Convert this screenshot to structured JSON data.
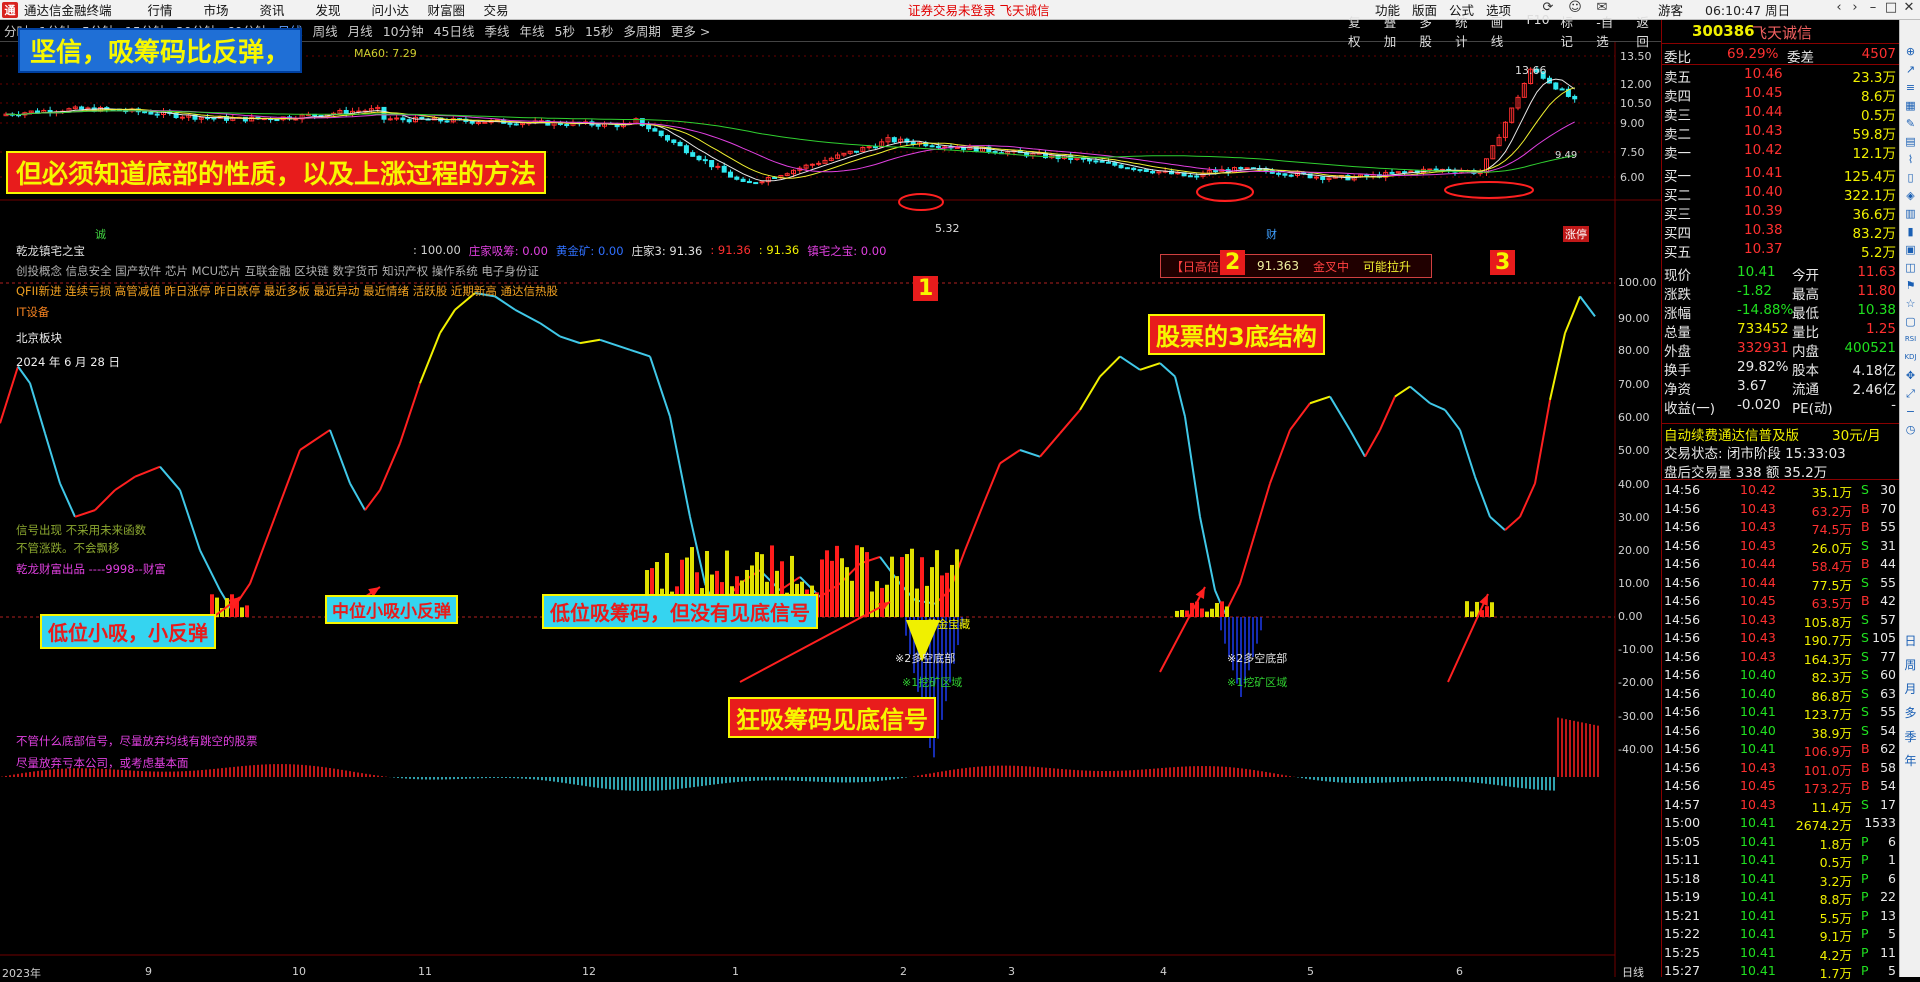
{
  "app": {
    "logo_text": "通",
    "title": "通达信金融终端",
    "menu": [
      "行情",
      "市场",
      "资讯",
      "发现",
      "问小达",
      "财富圈",
      "交易"
    ],
    "warning": "证券交易未登录  飞天诚信",
    "right_menu": [
      "功能",
      "版面",
      "公式",
      "选项"
    ],
    "guest": "游客",
    "clock": "06:10:47 周日"
  },
  "toolbar": {
    "periods": [
      "分时",
      "1分钟",
      "5分钟",
      "15分钟",
      "30分钟",
      "60分钟",
      "日线",
      "周线",
      "月线",
      "10分钟",
      "45日线",
      "季线",
      "年线",
      "5秒",
      "15秒",
      "多周期",
      "更多 >"
    ],
    "active_period": "日线",
    "tools": [
      "复权",
      "叠加",
      "多股",
      "统计",
      "画线",
      "F10",
      "标记",
      "-自选",
      "返回"
    ]
  },
  "kline": {
    "ma_label": "MA60: 7.29",
    "price_ticks": [
      "13.50",
      "12.00",
      "10.50",
      "9.00",
      "7.50",
      "6.00"
    ],
    "high_label": "13.66",
    "low_label": "5.32",
    "last_label": "9.49",
    "mark_cheng": "诚",
    "mark_cai": "财",
    "mark_zhangting": "涨停"
  },
  "indicator": {
    "name": "乾龙镇宅之宝",
    "params": [
      {
        "t": ": 100.00",
        "c": "#d0d0d0"
      },
      {
        "t": "庄家吸筹: 0.00",
        "c": "#e040e0"
      },
      {
        "t": "黄金矿: 0.00",
        "c": "#3070ff"
      },
      {
        "t": "庄家3: 91.36",
        "c": "#e0e0e0"
      },
      {
        "t": ": 91.36",
        "c": "#ff3030"
      },
      {
        "t": ": 91.36",
        "c": "#f0f000"
      },
      {
        "t": "镇宅之宝: 0.00",
        "c": "#e040e0"
      }
    ],
    "concepts": "创投概念 信息安全 国产软件 芯片 MCU芯片 互联金融 区块链 数字货币 知识产权 操作系统 电子身份证",
    "concepts2": "QFII新进 连续亏损 高管减值 昨日涨停 昨日跌停 最近多板 最近异动 最近情绪 活跃股 近期新高 通达信热股",
    "it": "IT设备",
    "bj": "北京板块",
    "date": "2024 年 6 月 28 日",
    "signal1": "信号出现  不采用未来函数",
    "signal2": "不管涨跌。不会飘移",
    "credit": "乾龙财富出品 ----9998--财富",
    "warn1": "不管什么底部信号，尽量放弃均线有跳空的股票",
    "warn2": "尽量放弃亏本公司，或考虑基本面",
    "ticks": [
      "100.00",
      "90.00",
      "80.00",
      "70.00",
      "60.00",
      "50.00",
      "40.00",
      "30.00",
      "20.00",
      "10.00",
      "0.00",
      "-10.00",
      "-20.00",
      "-30.00",
      "-40.00"
    ],
    "box_a": "【日高倍",
    "box_b": "91.363",
    "box_c": "金叉中",
    "box_d": "可能拉升",
    "note_gold": "※3黄金宝藏",
    "note_duokong1": "※2多空底部",
    "note_wak1": "※1挖矿区域",
    "note_duokong2": "※2多空底部",
    "note_wak2": "※1挖矿区域"
  },
  "xaxis": {
    "labels": [
      "2023年",
      "9",
      "10",
      "11",
      "12",
      "1",
      "2",
      "3",
      "4",
      "5",
      "6"
    ],
    "right": "日线"
  },
  "banners": {
    "b1": "坚信，吸筹码比反弹，",
    "b2": "但必须知道底部的性质，以及上涨过程的方法",
    "b3": "股票的3底结构",
    "n1": "1",
    "n2": "2",
    "n3": "3",
    "c1": "低位小吸，小反弹",
    "c2": "中位小吸小反弹",
    "c3": "低位吸筹码，但没有见底信号",
    "c4": "狂吸筹码见底信号"
  },
  "quote": {
    "code": "300386",
    "name": "飞天诚信",
    "weibi_label": "委比",
    "weibi": "69.29%",
    "weicha_label": "委差",
    "weicha": "4507",
    "asks": [
      {
        "l": "卖五",
        "p": "10.46",
        "v": "23.3万"
      },
      {
        "l": "卖四",
        "p": "10.45",
        "v": "8.6万"
      },
      {
        "l": "卖三",
        "p": "10.44",
        "v": "0.5万"
      },
      {
        "l": "卖二",
        "p": "10.43",
        "v": "59.8万"
      },
      {
        "l": "卖一",
        "p": "10.42",
        "v": "12.1万"
      }
    ],
    "bids": [
      {
        "l": "买一",
        "p": "10.41",
        "v": "125.4万"
      },
      {
        "l": "买二",
        "p": "10.40",
        "v": "322.1万"
      },
      {
        "l": "买三",
        "p": "10.39",
        "v": "36.6万"
      },
      {
        "l": "买四",
        "p": "10.38",
        "v": "83.2万"
      },
      {
        "l": "买五",
        "p": "10.37",
        "v": "5.2万"
      }
    ],
    "stats": [
      [
        {
          "t": "现价",
          "c": "wht"
        },
        {
          "t": "10.41",
          "c": "grn"
        },
        {
          "t": "今开",
          "c": "wht"
        },
        {
          "t": "11.63",
          "c": "red"
        }
      ],
      [
        {
          "t": "涨跌",
          "c": "wht"
        },
        {
          "t": "-1.82",
          "c": "grn"
        },
        {
          "t": "最高",
          "c": "wht"
        },
        {
          "t": "11.80",
          "c": "red"
        }
      ],
      [
        {
          "t": "涨幅",
          "c": "wht"
        },
        {
          "t": "-14.88%",
          "c": "grn"
        },
        {
          "t": "最低",
          "c": "wht"
        },
        {
          "t": "10.38",
          "c": "grn"
        }
      ],
      [
        {
          "t": "总量",
          "c": "wht"
        },
        {
          "t": "733452",
          "c": "yel"
        },
        {
          "t": "量比",
          "c": "wht"
        },
        {
          "t": "1.25",
          "c": "red"
        }
      ],
      [
        {
          "t": "外盘",
          "c": "wht"
        },
        {
          "t": "332931",
          "c": "red"
        },
        {
          "t": "内盘",
          "c": "wht"
        },
        {
          "t": "400521",
          "c": "grn"
        }
      ],
      [
        {
          "t": "换手",
          "c": "wht"
        },
        {
          "t": "29.82%",
          "c": "wht"
        },
        {
          "t": "股本",
          "c": "wht"
        },
        {
          "t": "4.18亿",
          "c": "wht"
        }
      ],
      [
        {
          "t": "净资",
          "c": "wht"
        },
        {
          "t": "3.67",
          "c": "wht"
        },
        {
          "t": "流通",
          "c": "wht"
        },
        {
          "t": "2.46亿",
          "c": "wht"
        }
      ],
      [
        {
          "t": "收益(一)",
          "c": "wht"
        },
        {
          "t": "-0.020",
          "c": "wht"
        },
        {
          "t": "PE(动)",
          "c": "wht"
        },
        {
          "t": "-",
          "c": "wht"
        }
      ]
    ],
    "promo": "自动续费通达信普及版",
    "promo_price": "30元/月",
    "trade_state": "交易状态: 闭市阶段 15:33:03",
    "after": "盘后交易量 338 额 35.2万",
    "ticks": [
      [
        "14:56",
        "10.42",
        "35.1万",
        "S",
        "30"
      ],
      [
        "14:56",
        "10.43",
        "63.2万",
        "B",
        "70"
      ],
      [
        "14:56",
        "10.43",
        "74.5万",
        "B",
        "55"
      ],
      [
        "14:56",
        "10.43",
        "26.0万",
        "S",
        "31"
      ],
      [
        "14:56",
        "10.44",
        "58.4万",
        "B",
        "44"
      ],
      [
        "14:56",
        "10.44",
        "77.5万",
        "S",
        "55"
      ],
      [
        "14:56",
        "10.45",
        "63.5万",
        "B",
        "42"
      ],
      [
        "14:56",
        "10.43",
        "105.8万",
        "S",
        "57"
      ],
      [
        "14:56",
        "10.43",
        "190.7万",
        "S",
        "105"
      ],
      [
        "14:56",
        "10.43",
        "164.3万",
        "S",
        "77"
      ],
      [
        "14:56",
        "10.40",
        "82.3万",
        "S",
        "60"
      ],
      [
        "14:56",
        "10.40",
        "86.8万",
        "S",
        "63"
      ],
      [
        "14:56",
        "10.41",
        "123.7万",
        "S",
        "55"
      ],
      [
        "14:56",
        "10.40",
        "38.9万",
        "S",
        "54"
      ],
      [
        "14:56",
        "10.41",
        "106.9万",
        "B",
        "62"
      ],
      [
        "14:56",
        "10.43",
        "101.0万",
        "B",
        "58"
      ],
      [
        "14:56",
        "10.45",
        "173.2万",
        "B",
        "54"
      ],
      [
        "14:57",
        "10.43",
        "11.4万",
        "S",
        "17"
      ],
      [
        "15:00",
        "10.41",
        "2674.2万",
        "",
        "1533"
      ],
      [
        "15:05",
        "10.41",
        "1.8万",
        "P",
        "6"
      ],
      [
        "15:11",
        "10.41",
        "0.5万",
        "P",
        "1"
      ],
      [
        "15:18",
        "10.41",
        "3.2万",
        "P",
        "6"
      ],
      [
        "15:19",
        "10.41",
        "8.8万",
        "P",
        "22"
      ],
      [
        "15:21",
        "10.41",
        "5.5万",
        "P",
        "13"
      ],
      [
        "15:22",
        "10.41",
        "9.1万",
        "P",
        "5"
      ],
      [
        "15:25",
        "10.41",
        "4.2万",
        "P",
        "11"
      ],
      [
        "15:27",
        "10.41",
        "1.7万",
        "P",
        "5"
      ]
    ]
  },
  "sidebar_icons": [
    "pin-icon",
    "arrow-icon",
    "list-icon",
    "grid-icon",
    "draw-icon",
    "table-icon",
    "chart-icon",
    "doc-icon",
    "cube-icon",
    "panel-icon",
    "bars-icon",
    "box-icon",
    "layers-icon",
    "flag-icon",
    "star-icon",
    "window-icon",
    "rsi-icon",
    "kdj-icon",
    "move-icon",
    "expand-icon",
    "minus-icon",
    "clock-icon",
    "ri-label",
    "zhou-label",
    "yue-label",
    "duo-label",
    "ji-label",
    "nian-label"
  ],
  "sidebar_text": {
    "ri": "日",
    "zhou": "周",
    "yue": "月",
    "duo": "多",
    "ji": "季",
    "nian": "年",
    "rsi": "RSI",
    "kdj": "KDJ"
  }
}
